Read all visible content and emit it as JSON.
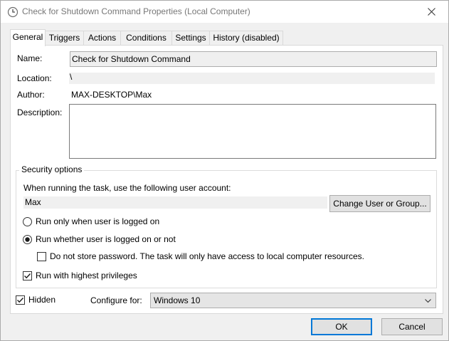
{
  "window": {
    "title": "Check for Shutdown Command Properties (Local Computer)"
  },
  "tabs": [
    {
      "label": "General",
      "active": true
    },
    {
      "label": "Triggers"
    },
    {
      "label": "Actions"
    },
    {
      "label": "Conditions"
    },
    {
      "label": "Settings"
    },
    {
      "label": "History (disabled)"
    }
  ],
  "general": {
    "name_label": "Name:",
    "name_value": "Check for Shutdown Command",
    "location_label": "Location:",
    "location_value": "\\",
    "author_label": "Author:",
    "author_value": "MAX-DESKTOP\\Max",
    "description_label": "Description:",
    "description_value": ""
  },
  "security": {
    "group_title": "Security options",
    "account_prompt": "When running the task, use the following user account:",
    "user_account": "Max",
    "change_user_button": "Change User or Group...",
    "radio_logged_on": {
      "label": "Run only when user is logged on",
      "checked": false
    },
    "radio_whether": {
      "label": "Run whether user is logged on or not",
      "checked": true
    },
    "do_not_store_password": {
      "label": "Do not store password.  The task will only have access to local computer resources.",
      "checked": false
    },
    "highest_privileges": {
      "label": "Run with highest privileges",
      "checked": true
    }
  },
  "bottom": {
    "hidden": {
      "label": "Hidden",
      "checked": true
    },
    "configure_label": "Configure for:",
    "configure_value": "Windows 10"
  },
  "footer": {
    "ok_label": "OK",
    "cancel_label": "Cancel"
  },
  "colors": {
    "default_button_border": "#0078d7",
    "window_bg": "#f0f0f0"
  },
  "icons": [
    "task-scheduler-clock-icon",
    "close-icon",
    "chevron-down-icon",
    "checkmark-icon"
  ]
}
